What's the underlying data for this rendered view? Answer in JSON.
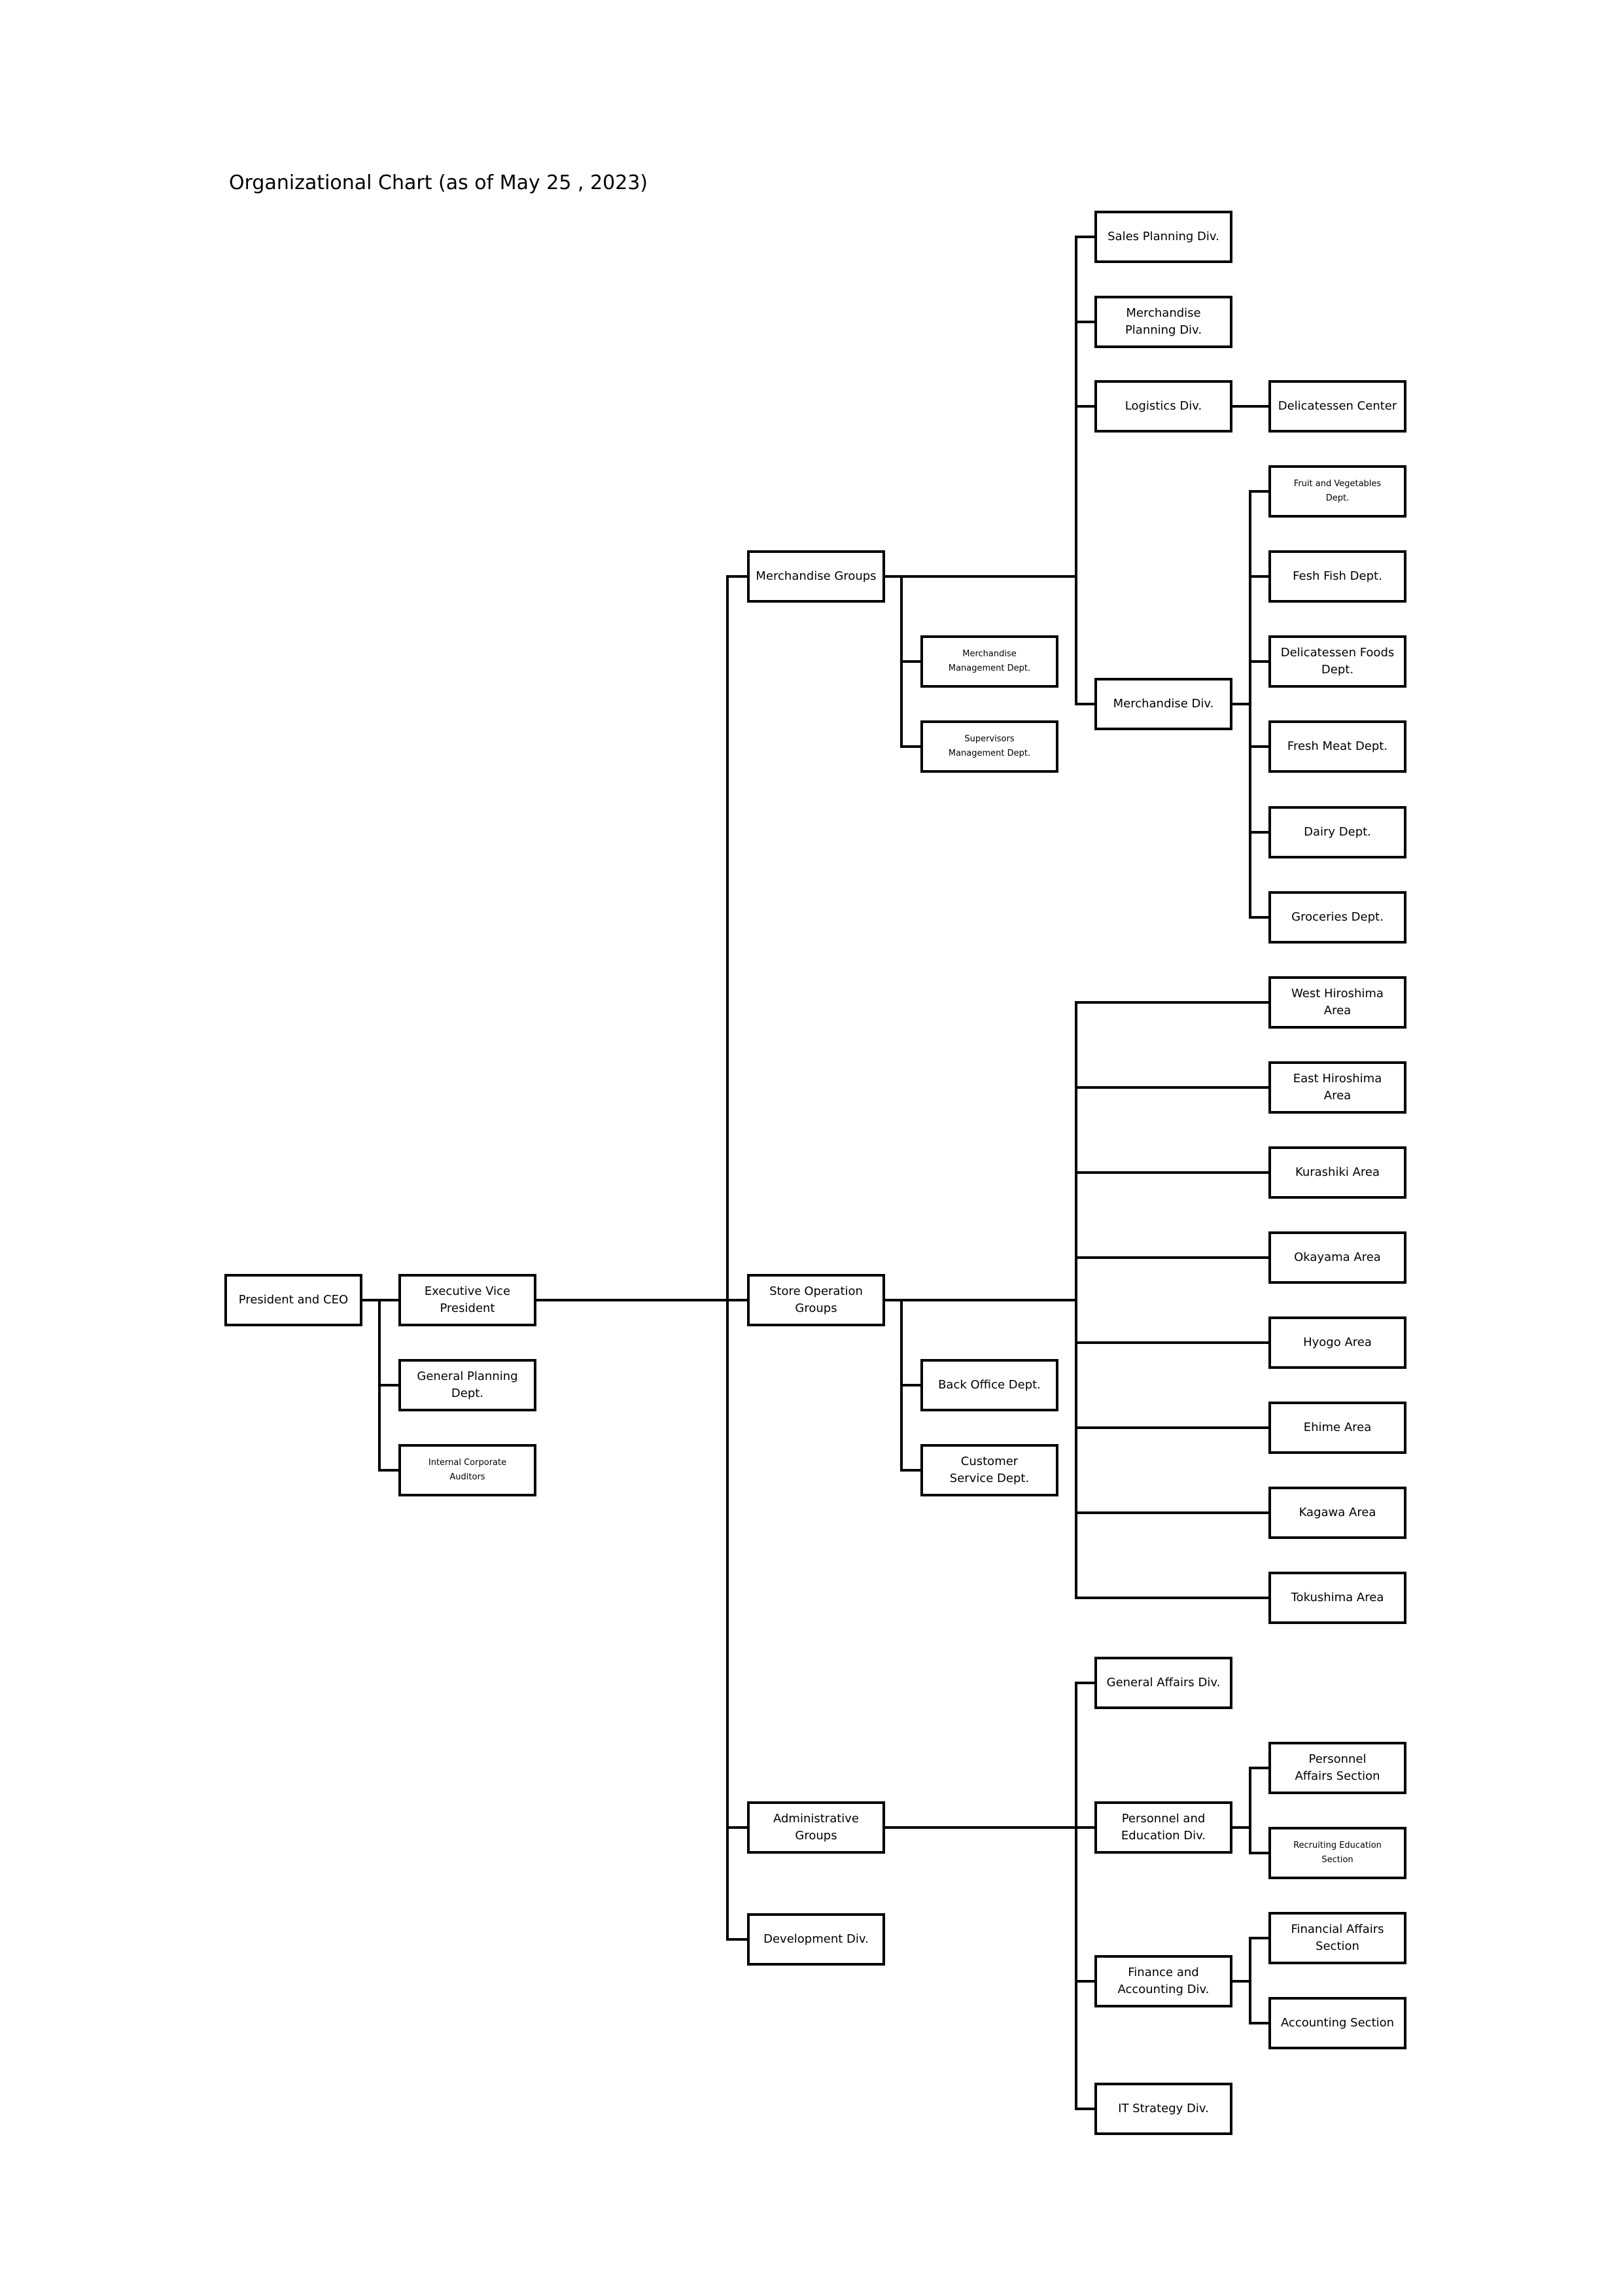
{
  "title": "Organizational Chart (as of May 25 , 2023)",
  "units": {
    "president": "President and CEO",
    "evp": "Executive Vice\nPresident",
    "general_planning": "General   Planning\nDept.",
    "internal_auditors": "Internal Corporate\nAuditors",
    "merchandise_groups": "Merchandise Groups",
    "store_operation_groups": "Store Operation\nGroups",
    "administrative_groups": "Administrative\nGroups",
    "development_div": "Development Div.",
    "merchandise_management": "Merchandise\nManagement Dept.",
    "supervisors_management": "Supervisors\nManagement Dept.",
    "back_office": "Back Office Dept.",
    "customer_service": "Customer\nService Dept.",
    "sales_planning": "Sales Planning Div.",
    "merchandise_planning": "Merchandise\nPlanning Div.",
    "logistics": "Logistics Div.",
    "delicatessen_center": "Delicatessen Center",
    "merchandise_div": "Merchandise Div.",
    "fruit_vegetables": "Fruit and Vegetables\nDept.",
    "fresh_fish": "Fesh Fish Dept.",
    "delicatessen_foods": "Delicatessen Foods\nDept.",
    "fresh_meat": "Fresh Meat Dept.",
    "dairy": "Dairy Dept.",
    "groceries": "Groceries Dept.",
    "west_hiroshima": "West   Hiroshima\nArea",
    "east_hiroshima": "East   Hiroshima\nArea",
    "kurashiki": "Kurashiki Area",
    "okayama": "Okayama Area",
    "hyogo": "Hyogo Area",
    "ehime": "Ehime   Area",
    "kagawa": "Kagawa Area",
    "tokushima": "Tokushima Area",
    "general_affairs": "General Affairs Div.",
    "personnel_education": "Personnel and\nEducation Div.",
    "personnel_affairs": "Personnel\nAffairs Section",
    "recruiting_education": "Recruiting Education\nSection",
    "finance_accounting": "Finance and\nAccounting Div.",
    "financial_affairs": "Financial Affairs\nSection",
    "accounting_section": "Accounting Section",
    "it_strategy": "IT Strategy Div."
  },
  "hierarchy": {
    "president": [
      "evp",
      "general_planning",
      "internal_auditors"
    ],
    "evp": [
      "merchandise_groups",
      "store_operation_groups",
      "administrative_groups",
      "development_div"
    ],
    "merchandise_groups": [
      "merchandise_management",
      "supervisors_management",
      "sales_planning",
      "merchandise_planning",
      "logistics",
      "merchandise_div"
    ],
    "logistics": [
      "delicatessen_center"
    ],
    "merchandise_div": [
      "fruit_vegetables",
      "fresh_fish",
      "delicatessen_foods",
      "fresh_meat",
      "dairy",
      "groceries"
    ],
    "store_operation_groups": [
      "back_office",
      "customer_service",
      "west_hiroshima",
      "east_hiroshima",
      "kurashiki",
      "okayama",
      "hyogo",
      "ehime",
      "kagawa",
      "tokushima"
    ],
    "administrative_groups": [
      "general_affairs",
      "personnel_education",
      "finance_accounting",
      "it_strategy"
    ],
    "personnel_education": [
      "personnel_affairs",
      "recruiting_education"
    ],
    "finance_accounting": [
      "financial_affairs",
      "accounting_section"
    ]
  },
  "colors": {
    "line": "#000000",
    "box_fill": "#ffffff",
    "text": "#000000"
  }
}
